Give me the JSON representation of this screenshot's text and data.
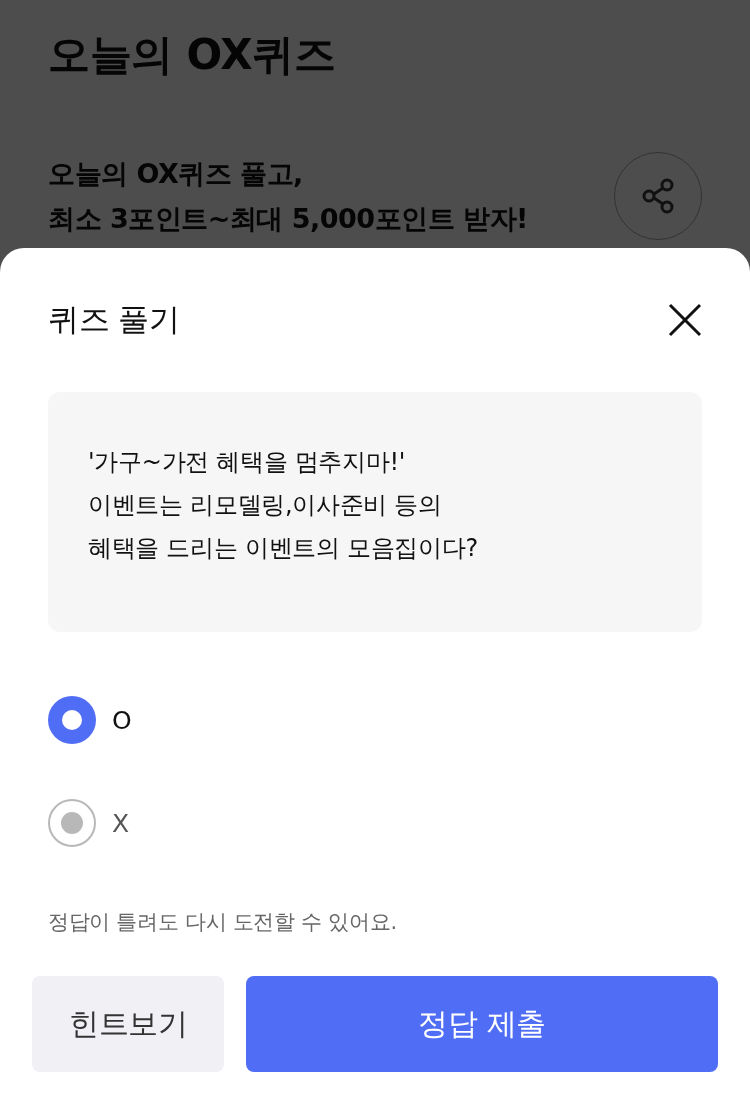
{
  "page": {
    "title": "오늘의 OX퀴즈",
    "subtitle_lines": [
      "오늘의 OX퀴즈 풀고,",
      "최소 3포인트~최대 5,000포인트 받자!"
    ]
  },
  "sheet": {
    "title": "퀴즈 풀기",
    "question_lines": [
      "'가구~가전 혜택을 멈추지마!'",
      "이벤트는 리모델링,이사준비 등의",
      "혜택을 드리는 이벤트의 모음집이다?"
    ],
    "options": [
      {
        "label": "O",
        "selected": true
      },
      {
        "label": "X",
        "selected": false
      }
    ],
    "note": "정답이 틀려도 다시 도전할 수 있어요.",
    "buttons": [
      {
        "kind": "secondary",
        "label": "힌트보기"
      },
      {
        "kind": "primary",
        "label": "정답 제출"
      }
    ]
  }
}
